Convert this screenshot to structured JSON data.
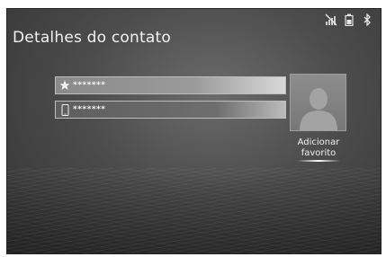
{
  "header": {
    "title": "Detalhes do contato"
  },
  "status_icons": [
    "no-signal-icon",
    "battery-icon",
    "bluetooth-icon"
  ],
  "fields": [
    {
      "icon": "star-icon",
      "value": "*******"
    },
    {
      "icon": "mobile-phone-icon",
      "value": "*******"
    }
  ],
  "favorite": {
    "line1": "Adicionar",
    "line2": "favorito"
  },
  "colors": {
    "background": "#4a4a4a",
    "text": "#f2f2f2"
  }
}
